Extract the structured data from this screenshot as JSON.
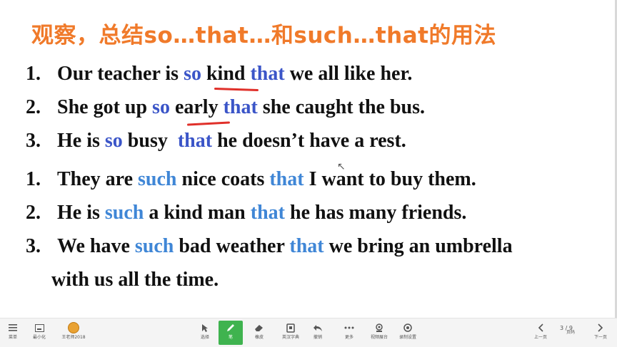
{
  "slide": {
    "title": "观察，总结so…that…和such…that的用法",
    "so_sentences": [
      {
        "num": "1.",
        "a": "Our teacher is ",
        "k1": "so",
        "b": " kind ",
        "k2": "that",
        "c": " we all like her."
      },
      {
        "num": "2.",
        "a": "She got up ",
        "k1": "so",
        "b": " early ",
        "k2": "that",
        "c": " she caught the bus."
      },
      {
        "num": "3.",
        "a": "He is ",
        "k1": "so",
        "b": " busy  ",
        "k2": "that",
        "c": " he doesn’t have a rest."
      }
    ],
    "such_sentences": [
      {
        "num": "1.",
        "a": "They are ",
        "k1": "such",
        "b": " nice coats ",
        "k2": "that",
        "c": " I want to buy them."
      },
      {
        "num": "2.",
        "a": "He is ",
        "k1": "such",
        "b": " a kind man ",
        "k2": "that",
        "c": " he has many friends."
      },
      {
        "num": "3.",
        "a": "We have ",
        "k1": "such",
        "b": " bad weather ",
        "k2": "that",
        "c": " we bring an umbrella",
        "cont": "with us all the time."
      }
    ],
    "colors": {
      "title": "#f07a2a",
      "keyword_so": "#3b55c8",
      "keyword_such": "#3f86d6",
      "underline": "#e0302a"
    }
  },
  "toolbar": {
    "menu": "菜单",
    "minimize": "最小化",
    "user": "王老师2018",
    "select": "选择",
    "pen": "笔",
    "eraser": "橡皮",
    "dictionary": "英汉字典",
    "undo": "撤销",
    "more": "更多",
    "video_booth": "视频展台",
    "record_settings": "录制设置",
    "page_indicator": "3 / 9",
    "prev": "上一页",
    "page": "页码",
    "next": "下一页"
  }
}
